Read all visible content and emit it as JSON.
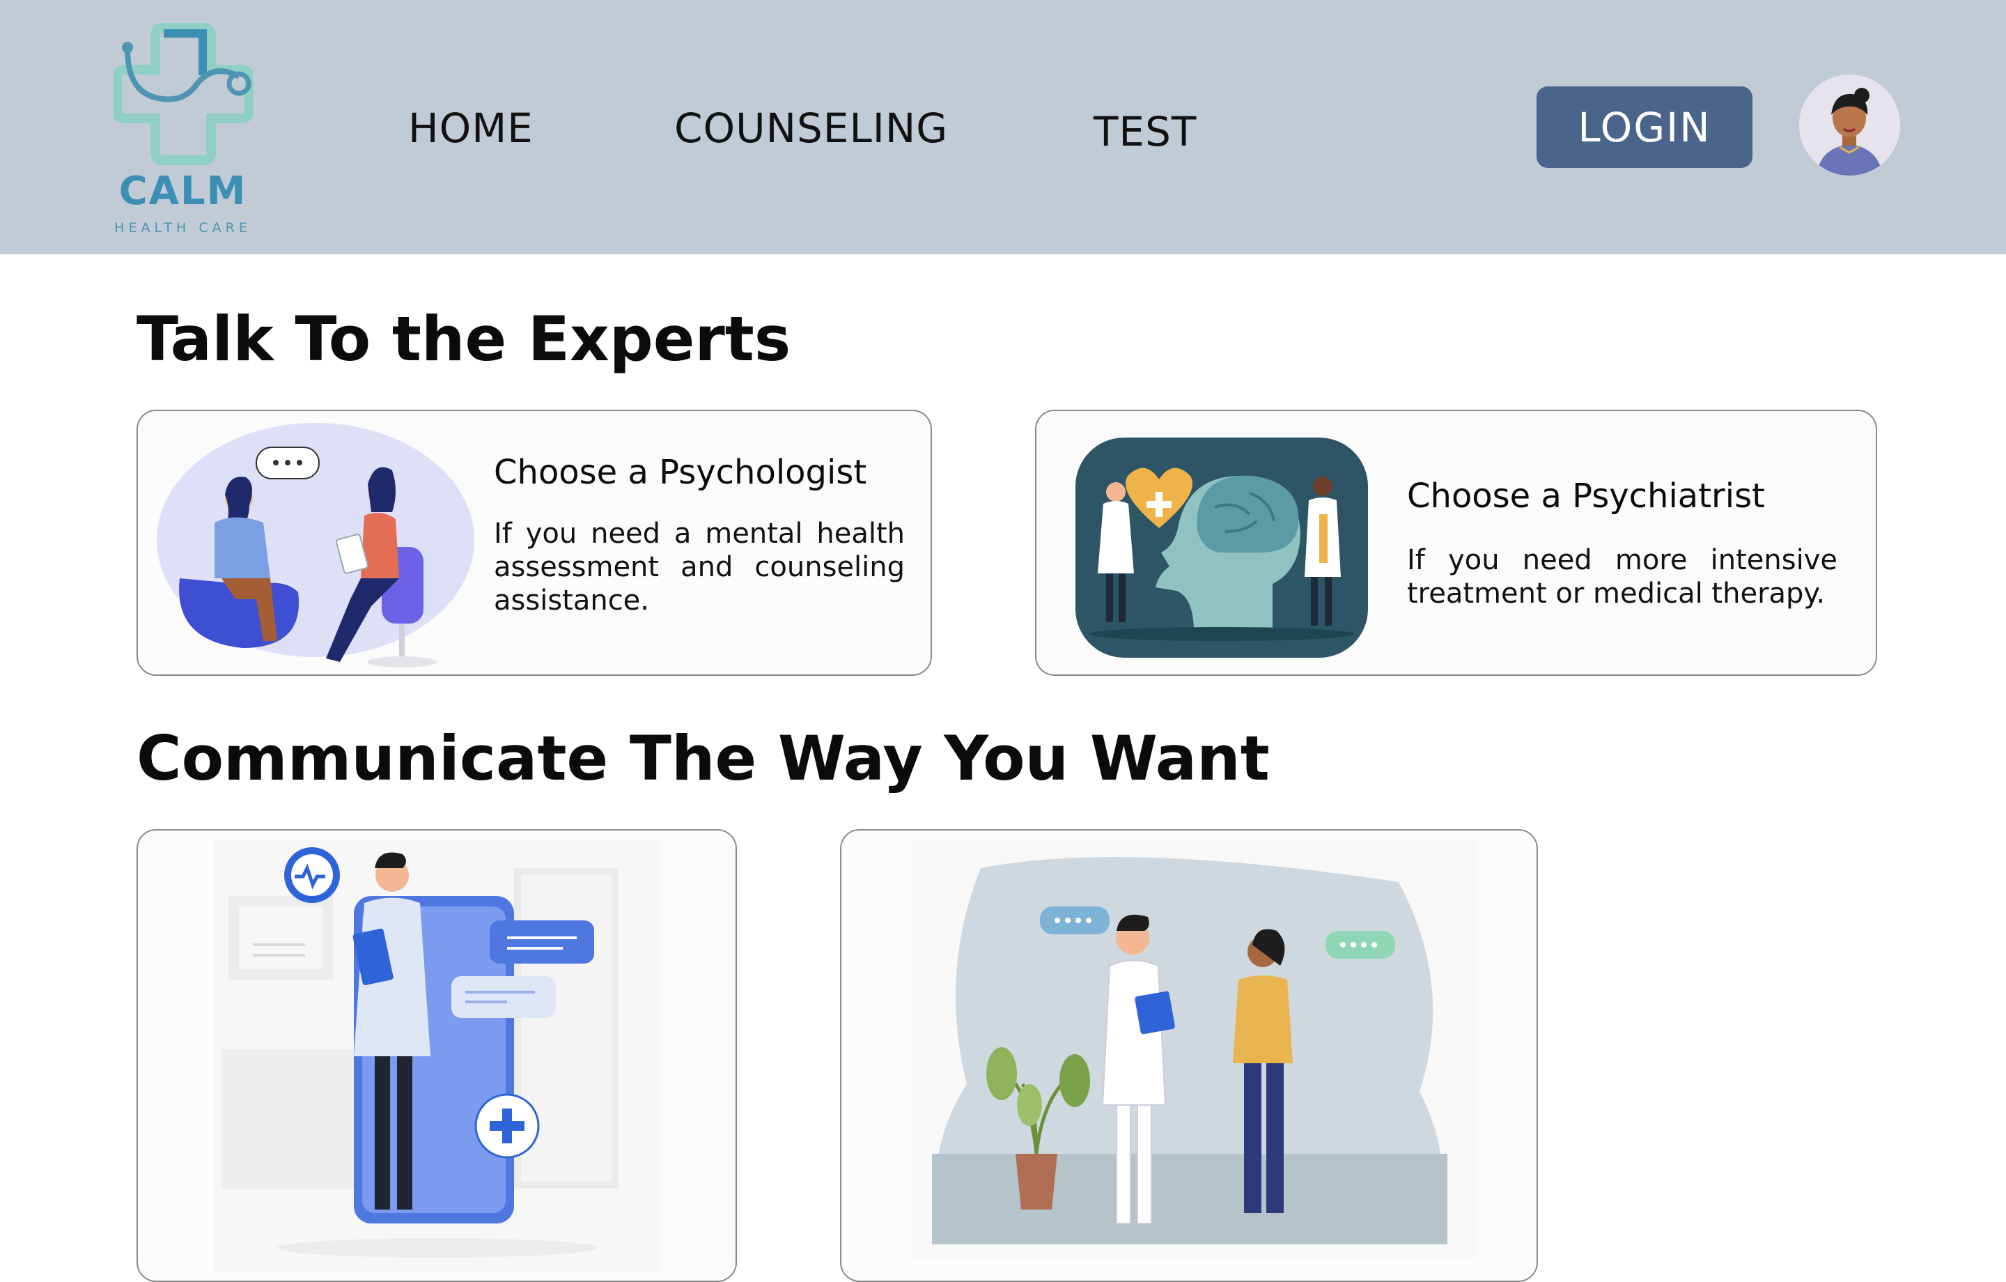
{
  "header": {
    "logo_name": "CALM",
    "logo_subtitle": "HEALTH CARE",
    "nav": [
      {
        "label": "HOME"
      },
      {
        "label": "COUNSELING"
      },
      {
        "label": "TEST"
      }
    ],
    "login_label": "LOGIN"
  },
  "experts": {
    "title": "Talk To the Experts",
    "cards": [
      {
        "title": "Choose a Psychologist",
        "description": "If you need a mental health assessment and counseling assistance."
      },
      {
        "title": "Choose a Psychiatrist",
        "description": "If you need more intensive treatment or medical therapy."
      }
    ]
  },
  "communicate": {
    "title": "Communicate The Way You Want"
  },
  "colors": {
    "header_bg": "#c1cbd6",
    "login_bg": "#4a6589",
    "logo_accent": "#3c8fb4",
    "card_border": "#8a8a8a"
  }
}
